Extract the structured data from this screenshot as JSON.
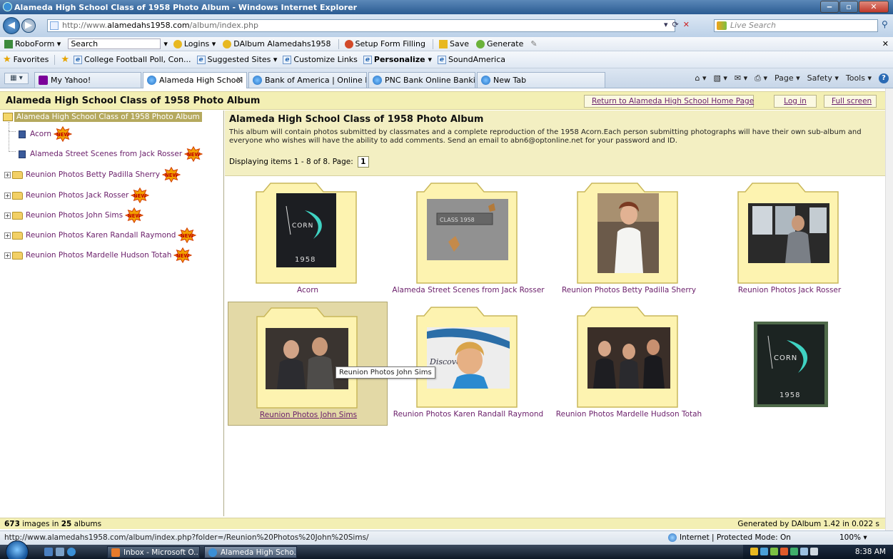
{
  "window": {
    "title": "Alameda High School Class of 1958 Photo Album - Windows Internet Explorer",
    "url_prefix": "http://www.",
    "url_domain": "alamedahs1958.com",
    "url_path": "/album/index.php",
    "live_search_placeholder": "Live Search"
  },
  "robobar": {
    "robo_label": "RoboForm ▾",
    "search_value": "Search",
    "logins": "Logins ▾",
    "dalbum": "DAlbum Alamedahs1958",
    "setup": "Setup Form Filling",
    "save": "Save",
    "generate": "Generate"
  },
  "favbar": {
    "favorites": "Favorites",
    "items": [
      "College Football Poll, Con...",
      "Suggested Sites ▾",
      "Customize Links",
      "Personalize ▾",
      "SoundAmerica"
    ]
  },
  "tabs": [
    {
      "label": "My Yahoo!"
    },
    {
      "label": "Alameda High School ..."
    },
    {
      "label": "Bank of America | Online B..."
    },
    {
      "label": "PNC Bank Online Banking"
    },
    {
      "label": "New Tab"
    }
  ],
  "cmdbar": {
    "page": "Page ▾",
    "safety": "Safety ▾",
    "tools": "Tools ▾"
  },
  "page": {
    "site_title": "Alameda High School Class of 1958 Photo Album",
    "return_link": "Return to Alameda High School Home Page",
    "login_link": "Log in",
    "fullscreen_link": "Full screen"
  },
  "tree": {
    "root": "Alameda High School Class of 1958 Photo Album",
    "items": [
      "Acorn",
      "Alameda Street Scenes from Jack Rosser",
      "Reunion Photos Betty Padilla Sherry",
      "Reunion Photos Jack Rosser",
      "Reunion Photos John Sims",
      "Reunion Photos Karen Randall Raymond",
      "Reunion Photos Mardelle Hudson Totah"
    ],
    "new_badge": "NEW"
  },
  "album": {
    "title": "Alameda High School Class of 1958 Photo Album",
    "description": "This album will contain photos submitted by classmates and a complete reproduction of the 1958 Acorn.Each person submitting photographs will have their own sub-album and everyone who wishes will have the ability to add comments. Send an email to abn6@optonline.net for your password and ID.",
    "displaying": "Displaying items 1 - 8 of 8.  Page:",
    "page_number": "1"
  },
  "thumbs": [
    {
      "caption": "Acorn"
    },
    {
      "caption": "Alameda Street Scenes from Jack Rosser"
    },
    {
      "caption": "Reunion Photos Betty Padilla Sherry"
    },
    {
      "caption": "Reunion Photos Jack Rosser"
    },
    {
      "caption": "Reunion Photos John Sims"
    },
    {
      "caption": "Reunion Photos Karen Randall Raymond"
    },
    {
      "caption": "Reunion Photos Mardelle Hudson Totah"
    }
  ],
  "cover_text": {
    "acorn_word": "CORN",
    "acorn_year": "1958",
    "plaque": "CLASS 1958",
    "discover": "Discover"
  },
  "tooltip": "Reunion Photos John Sims",
  "footer": {
    "count_images": "673",
    "images_in": "images in",
    "count_albums": "25",
    "albums": "albums",
    "generated": "Generated by DAlbum 1.42 in 0.022 s"
  },
  "status": {
    "url": "http://www.alamedahs1958.com/album/index.php?folder=/Reunion%20Photos%20John%20Sims/",
    "zone": "Internet | Protected Mode: On",
    "zoom": "100%  ▾"
  },
  "taskbar": {
    "items": [
      "Inbox - Microsoft O...",
      "Alameda High Scho..."
    ],
    "clock": "8:38 AM"
  }
}
